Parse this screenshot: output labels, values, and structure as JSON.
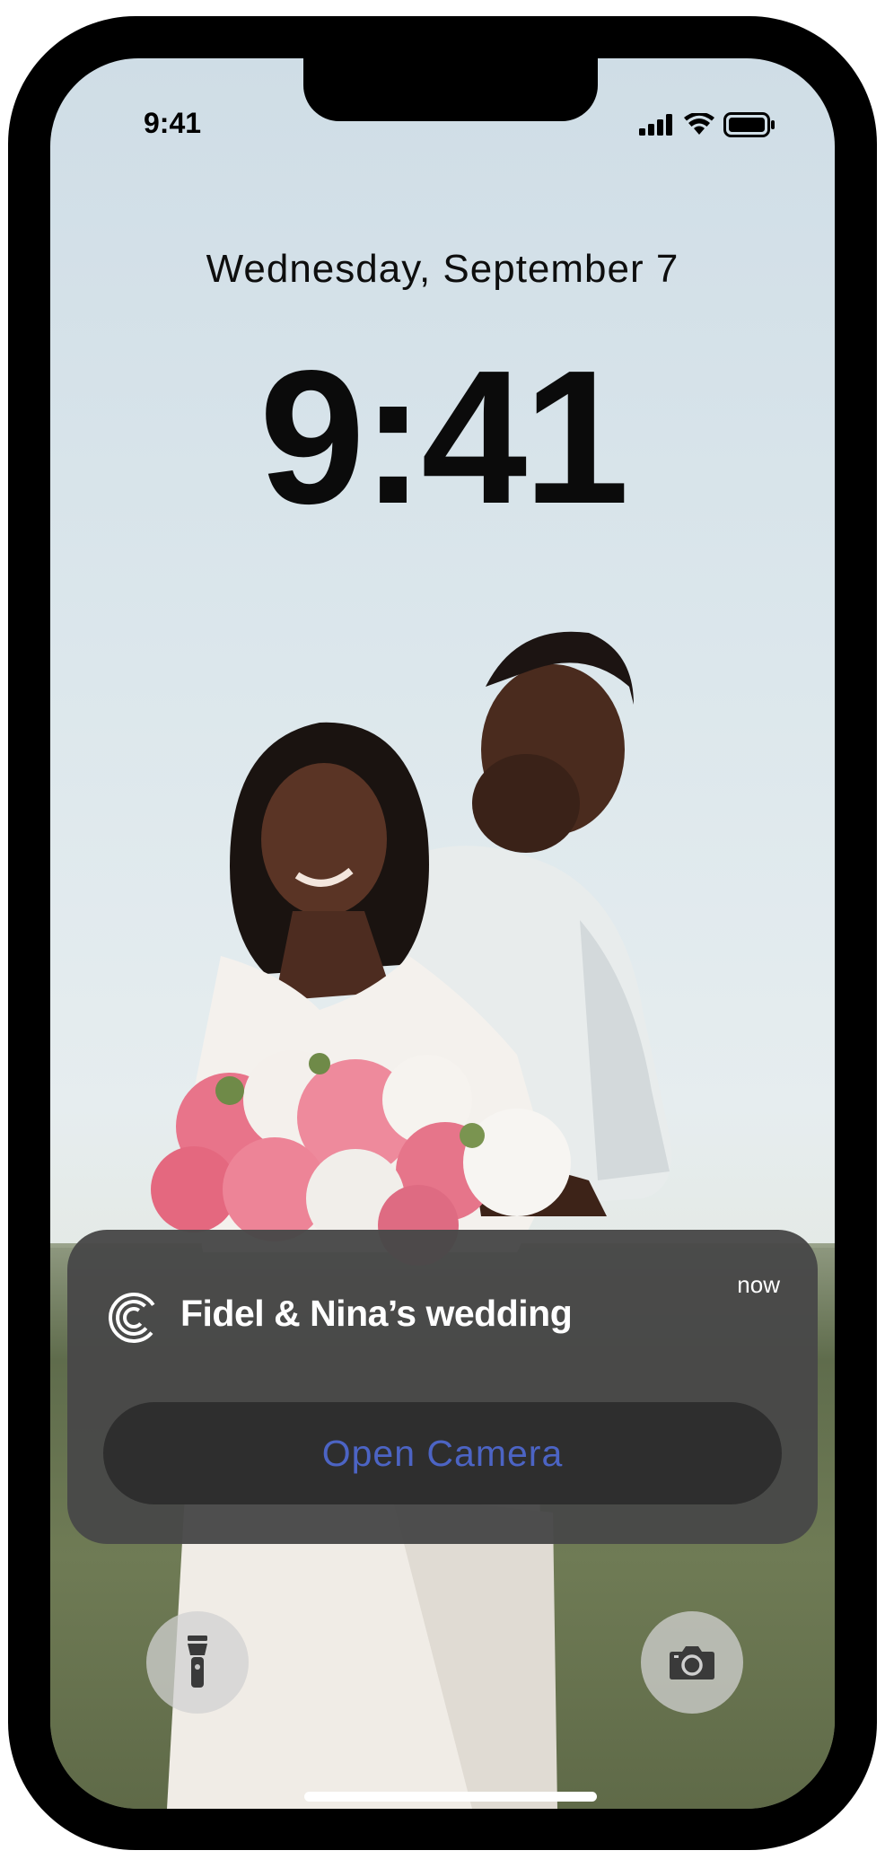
{
  "status_bar": {
    "time": "9:41"
  },
  "lock_screen": {
    "date": "Wednesday, September 7",
    "time": "9:41"
  },
  "notification": {
    "app_icon": "camera-app-logo-icon",
    "title": "Fidel & Nina’s wedding",
    "timestamp": "now",
    "action_label": "Open Camera"
  },
  "quick_actions": {
    "left_icon": "flashlight-icon",
    "right_icon": "camera-icon"
  },
  "colors": {
    "notification_bg": "#484848",
    "action_text": "#4c64c4"
  }
}
